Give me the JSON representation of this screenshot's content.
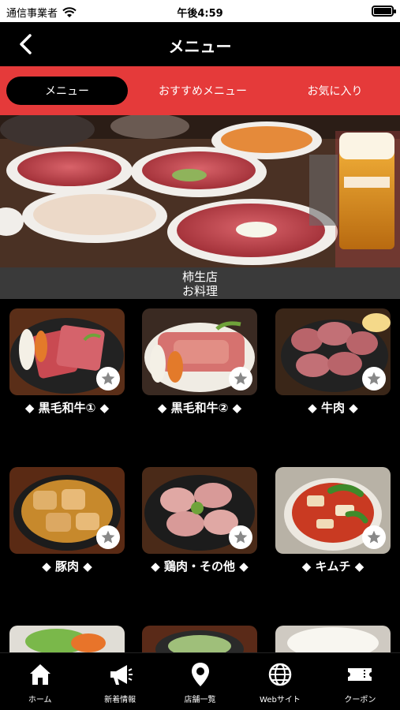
{
  "status": {
    "carrier": "通信事業者",
    "time": "午後4:59"
  },
  "nav": {
    "title": "メニュー"
  },
  "tabs": [
    {
      "label": "メニュー",
      "active": true
    },
    {
      "label": "おすすめメニュー",
      "active": false
    },
    {
      "label": "お気に入り",
      "active": false
    }
  ],
  "store": {
    "name": "柿生店",
    "category": "お料理"
  },
  "menu": [
    {
      "label": "◆ 黒毛和牛① ◆",
      "photo": "wagyu-plate"
    },
    {
      "label": "◆ 黒毛和牛② ◆",
      "photo": "wagyu-sliced"
    },
    {
      "label": "◆ 牛肉 ◆",
      "photo": "beef-tongue"
    },
    {
      "label": "◆ 豚肉 ◆",
      "photo": "pork-miso"
    },
    {
      "label": "◆ 鶏肉・その他 ◆",
      "photo": "chicken-plate"
    },
    {
      "label": "◆ キムチ ◆",
      "photo": "kimchi-bowl"
    },
    {
      "label": "",
      "photo": "salad"
    },
    {
      "label": "",
      "photo": "soup"
    },
    {
      "label": "",
      "photo": "rice"
    }
  ],
  "bottom_nav": [
    {
      "label": "ホーム",
      "icon": "home-icon"
    },
    {
      "label": "新着情報",
      "icon": "megaphone-icon"
    },
    {
      "label": "店舗一覧",
      "icon": "location-pin-icon"
    },
    {
      "label": "Webサイト",
      "icon": "globe-icon"
    },
    {
      "label": "クーポン",
      "icon": "ticket-icon"
    }
  ]
}
